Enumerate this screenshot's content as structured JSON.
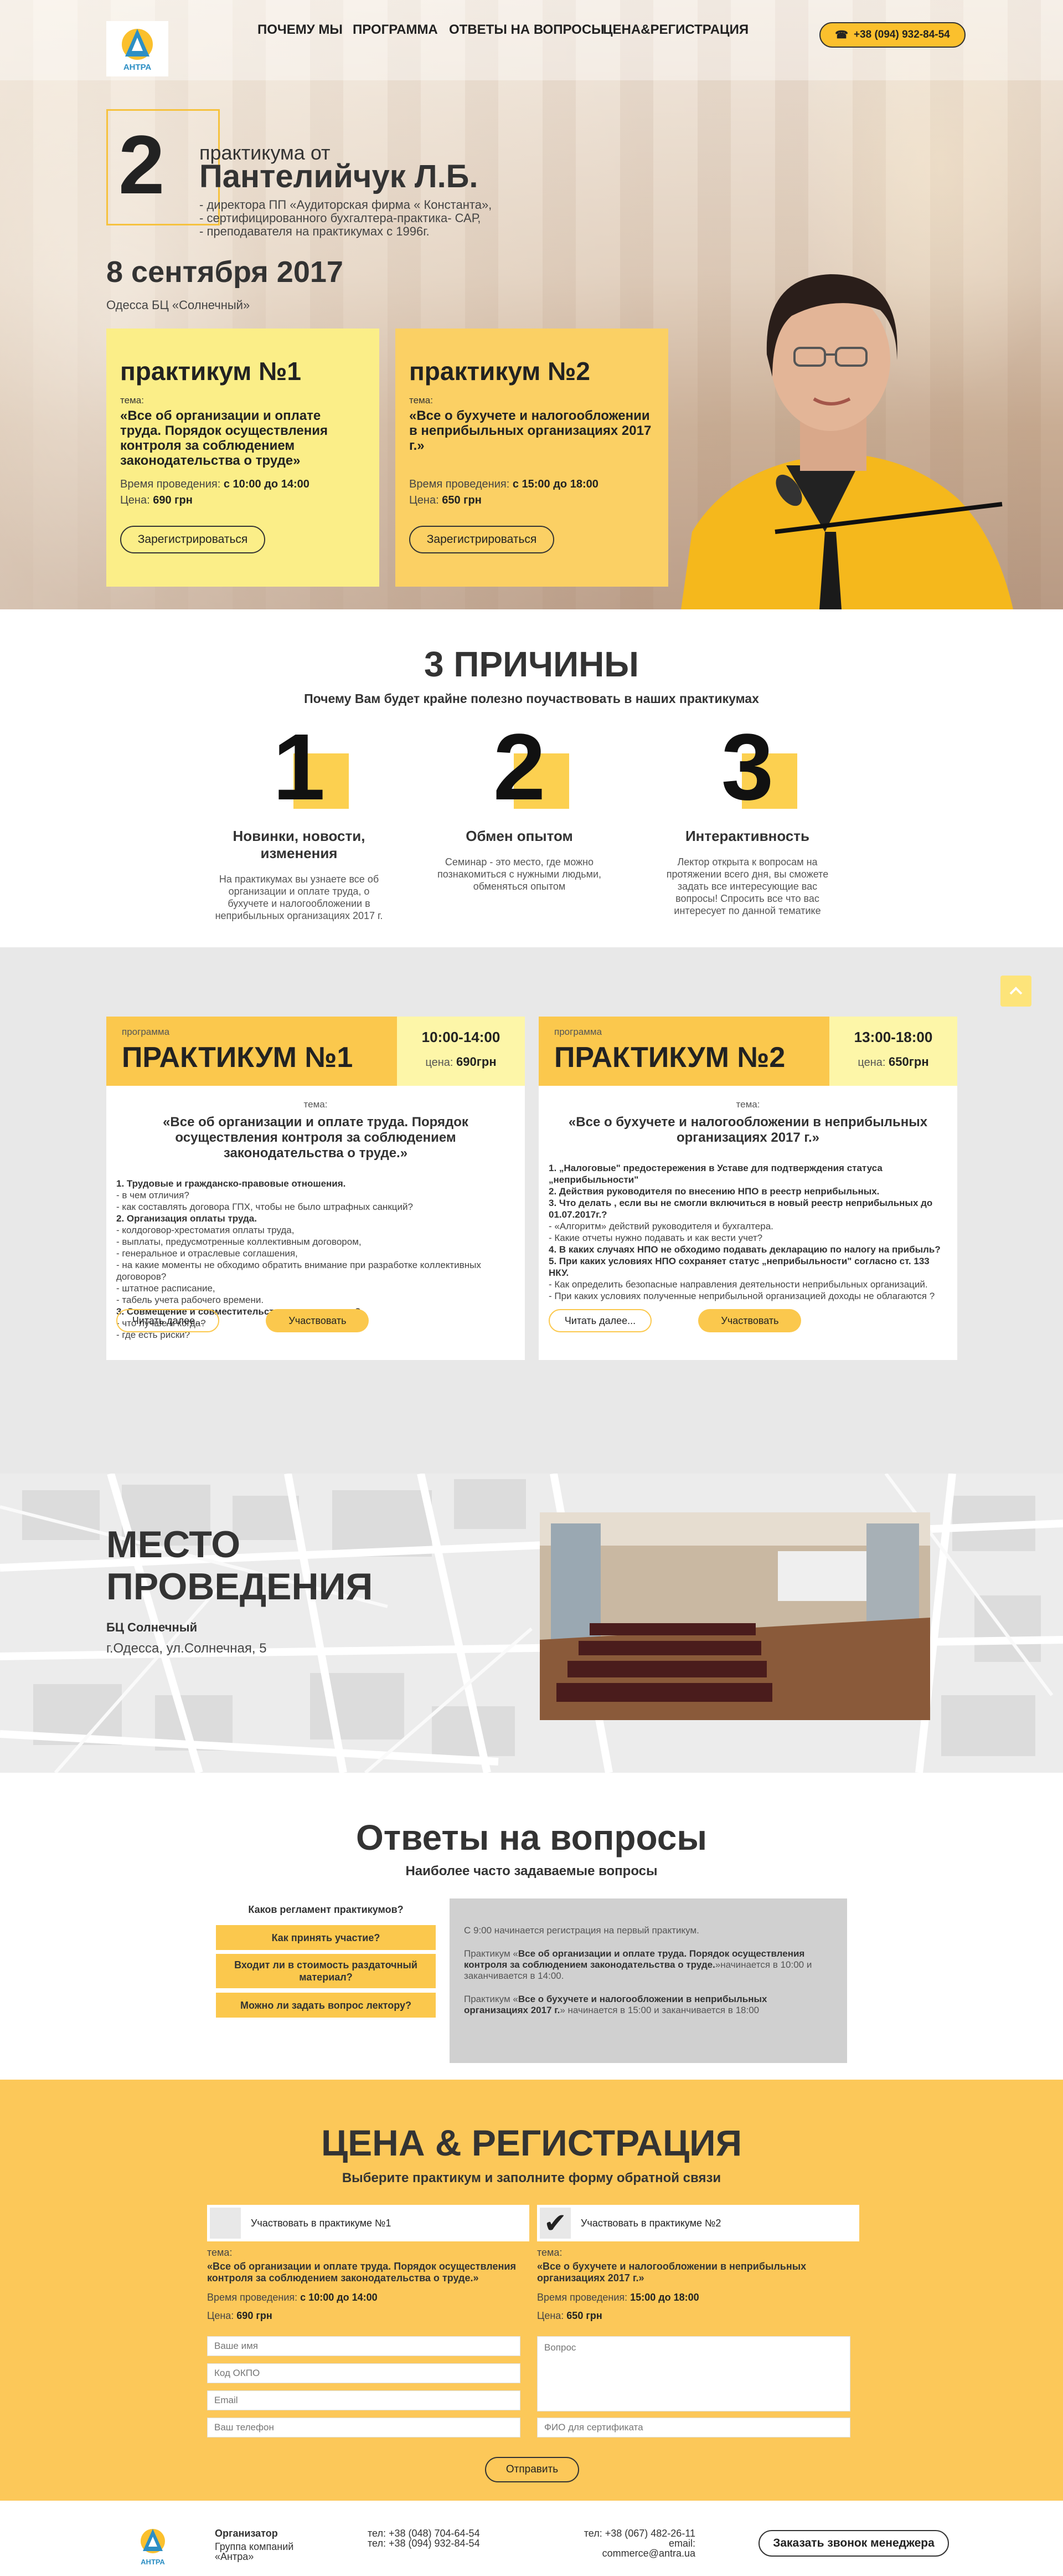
{
  "nav": {
    "logo_text": "АНТРА",
    "items": [
      "ПОЧЕМУ МЫ",
      "ПРОГРАММА",
      "ОТВЕТЫ НА ВОПРОСЫ",
      "ЦЕНА&РЕГИСТРАЦИЯ"
    ],
    "phone": "+38 (094) 932-84-54"
  },
  "hero": {
    "count": "2",
    "from": "практикума от",
    "name": "Пантелийчук Л.Б.",
    "lines": [
      "- директора ПП «Аудиторская фирма « Константа»,",
      "- сертифицированного бухгалтера-практика- САР,",
      "- преподавателя на практикумах с 1996г."
    ],
    "date": "8 сентября 2017",
    "place": "Одесса БЦ «Солнечный»",
    "cards": [
      {
        "title": "практикум №1",
        "label": "тема:",
        "topic": "«Все об организации и оплате труда. Порядок осуществления контроля за соблюдением законодательства о труде»",
        "time_label": "Время проведения:",
        "time": "с 10:00 до 14:00",
        "price_label": "Цена:",
        "price": "690 грн",
        "button": "Зарегистрироваться"
      },
      {
        "title": "практикум №2",
        "label": "тема:",
        "topic": "«Все о бухучете и налогообложении в неприбыльных организациях 2017 г.»",
        "time_label": "Время проведения:",
        "time": "с 15:00 до 18:00",
        "price_label": "Цена:",
        "price": "650 грн",
        "button": "Зарегистрироваться"
      }
    ]
  },
  "reasons": {
    "title": "3 ПРИЧИНЫ",
    "subtitle": "Почему Вам будет крайне полезно поучаствовать в наших практикумах",
    "items": [
      {
        "num": "1",
        "head": "Новинки, новости, изменения",
        "text": "На практикумах вы узнаете все об организации и оплате труда, о бухучете и налогообложении в неприбыльных организациях 2017 г."
      },
      {
        "num": "2",
        "head": "Обмен опытом",
        "text": "Семинар - это место, где можно познакомиться с нужными людьми, обменяться опытом"
      },
      {
        "num": "3",
        "head": "Интерактивность",
        "text": "Лектор открыта к вопросам на протяжении всего дня, вы сможете задать все интересующие вас вопросы! Спросить все что вас интересует по данной тематике"
      }
    ]
  },
  "program": {
    "cards": [
      {
        "small": "программа",
        "title": "ПРАКТИКУМ №1",
        "time": "10:00-14:00",
        "price_label": "цена:",
        "price": "690грн",
        "topic_label": "тема:",
        "topic": "«Все об организации и оплате труда. Порядок осуществления контроля за соблюдением законодательства о труде.»",
        "lines": [
          {
            "t": "1. Трудовые и гражданско-правовые отношения.",
            "b": true
          },
          {
            "t": "- в чем отличия?",
            "b": false
          },
          {
            "t": "- как составлять договора ГПХ, чтобы не было штрафных санкций?",
            "b": false
          },
          {
            "t": "2. Организация оплаты труда.",
            "b": true
          },
          {
            "t": "- колдоговор-хрестоматия оплаты труда,",
            "b": false
          },
          {
            "t": "- выплаты, предусмотренные коллективным договором,",
            "b": false
          },
          {
            "t": "- генеральное и отраслевые соглашения,",
            "b": false
          },
          {
            "t": "- на какие моменты не обходимо обратить внимание при разработке коллективных договоров?",
            "b": false
          },
          {
            "t": "- штатное расписание,",
            "b": false
          },
          {
            "t": "- табель учета рабочего времени.",
            "b": false
          },
          {
            "t": "3. Совмещение и совместительство в чем отличия?",
            "b": true
          },
          {
            "t": "- что лучше и когда?",
            "b": false
          },
          {
            "t": "- где есть риски?",
            "b": false
          }
        ],
        "more": "Читать далее...",
        "participate": "Участвовать"
      },
      {
        "small": "программа",
        "title": "ПРАКТИКУМ №2",
        "time": "13:00-18:00",
        "price_label": "цена:",
        "price": "650грн",
        "topic_label": "тема:",
        "topic": "«Все о бухучете и налогообложении в неприбыльных организациях 2017 г.»",
        "lines": [
          {
            "t": "1. „Налоговые\" предостережения в Уставе для подтверждения статуса „неприбыльности\"",
            "b": true
          },
          {
            "t": "2. Действия руководителя по внесению НПО в реестр неприбыльных.",
            "b": true
          },
          {
            "t": "3. Что делать , если вы не смогли включиться в новый реестр неприбыльных до 01.07.2017г.?",
            "b": true
          },
          {
            "t": "- «Алгоритм» действий руководителя и бухгалтера.",
            "b": false
          },
          {
            "t": "- Какие отчеты нужно подавать и как вести учет?",
            "b": false
          },
          {
            "t": "4. В каких случаях НПО не обходимо подавать декларацию по налогу на прибыль?",
            "b": true
          },
          {
            "t": "5. При каких условиях НПО сохраняет статус „неприбыльности\" согласно ст. 133 НКУ.",
            "b": true
          },
          {
            "t": "- Как определить безопасные направления деятельности неприбыльных организаций.",
            "b": false
          },
          {
            "t": "- При каких условиях полученные неприбыльной организацией доходы не облагаются ?",
            "b": false
          }
        ],
        "more": "Читать далее...",
        "participate": "Участвовать"
      }
    ]
  },
  "venue": {
    "title_line1": "МЕСТО",
    "title_line2": "ПРОВЕДЕНИЯ",
    "name": "БЦ Солнечный",
    "address": "г.Одесса, ул.Солнечная, 5"
  },
  "faq": {
    "title": "Ответы на вопросы",
    "subtitle": "Наиболее часто задаваемые вопросы",
    "questions": [
      "Каков регламент практикумов?",
      "Как принять участие?",
      "Входит ли в стоимость раздаточный материал?",
      "Можно ли задать вопрос лектору?"
    ],
    "answer_p1": "С 9:00 начинается регистрация на первый практикум.",
    "answer_p2_pre": "Практикум «",
    "answer_p2_bold": "Все об организации и оплате труда. Порядок осуществления контроля за соблюдением законодательства о труде.",
    "answer_p2_post": "»начинается в 10:00 и заканчивается в 14:00.",
    "answer_p3_pre": "Практикум «",
    "answer_p3_bold": "Все о бухучете и налогообложении в неприбыльных организациях 2017 г.",
    "answer_p3_post": "» начинается в 15:00 и заканчивается в 18:00"
  },
  "price": {
    "title": "ЦЕНА & РЕГИСТРАЦИЯ",
    "subtitle": "Выберите практикум и заполните форму обратной связи",
    "options": [
      {
        "label": "Участвовать в практикуме №1",
        "checked": false,
        "topic_label": "тема:",
        "topic": "«Все об организации и оплате труда. Порядок осуществления контроля за соблюдением законодательства о труде.»",
        "time_label": "Время проведения:",
        "time": "с 10:00 до 14:00",
        "price_label": "Цена:",
        "price": "690 грн"
      },
      {
        "label": "Участвовать в практикуме №2",
        "checked": true,
        "topic_label": "тема:",
        "topic": "«Все о бухучете и налогообложении в неприбыльных организациях 2017 г.»",
        "time_label": "Время проведения:",
        "time": "15:00 до 18:00",
        "price_label": "Цена:",
        "price": "650 грн"
      }
    ],
    "placeholders": {
      "name": "Ваше имя",
      "okpo": "Код ОКПО",
      "email": "Email",
      "phone": "Ваш телефон",
      "question": "Вопрос",
      "cert": "ФИО для сертификата"
    },
    "send": "Отправить"
  },
  "footer": {
    "org_label": "Организатор",
    "org_line1": "Группа компаний",
    "org_line2": "«Антра»",
    "tel1": "тел: +38 (048) 704-64-54",
    "tel2": "тел: +38 (094) 932-84-54",
    "tel3": "тел: +38 (067) 482-26-11",
    "email": "email: commerce@antra.ua",
    "manager": "Заказать звонок менеджера"
  },
  "colors": {
    "accent": "#fbc84d",
    "accent_light": "#fbee88",
    "accent_pale": "#fdf6a8",
    "text": "#333333",
    "program_bg": "#e8e8e8",
    "answer_bg": "#d0d0d0"
  }
}
